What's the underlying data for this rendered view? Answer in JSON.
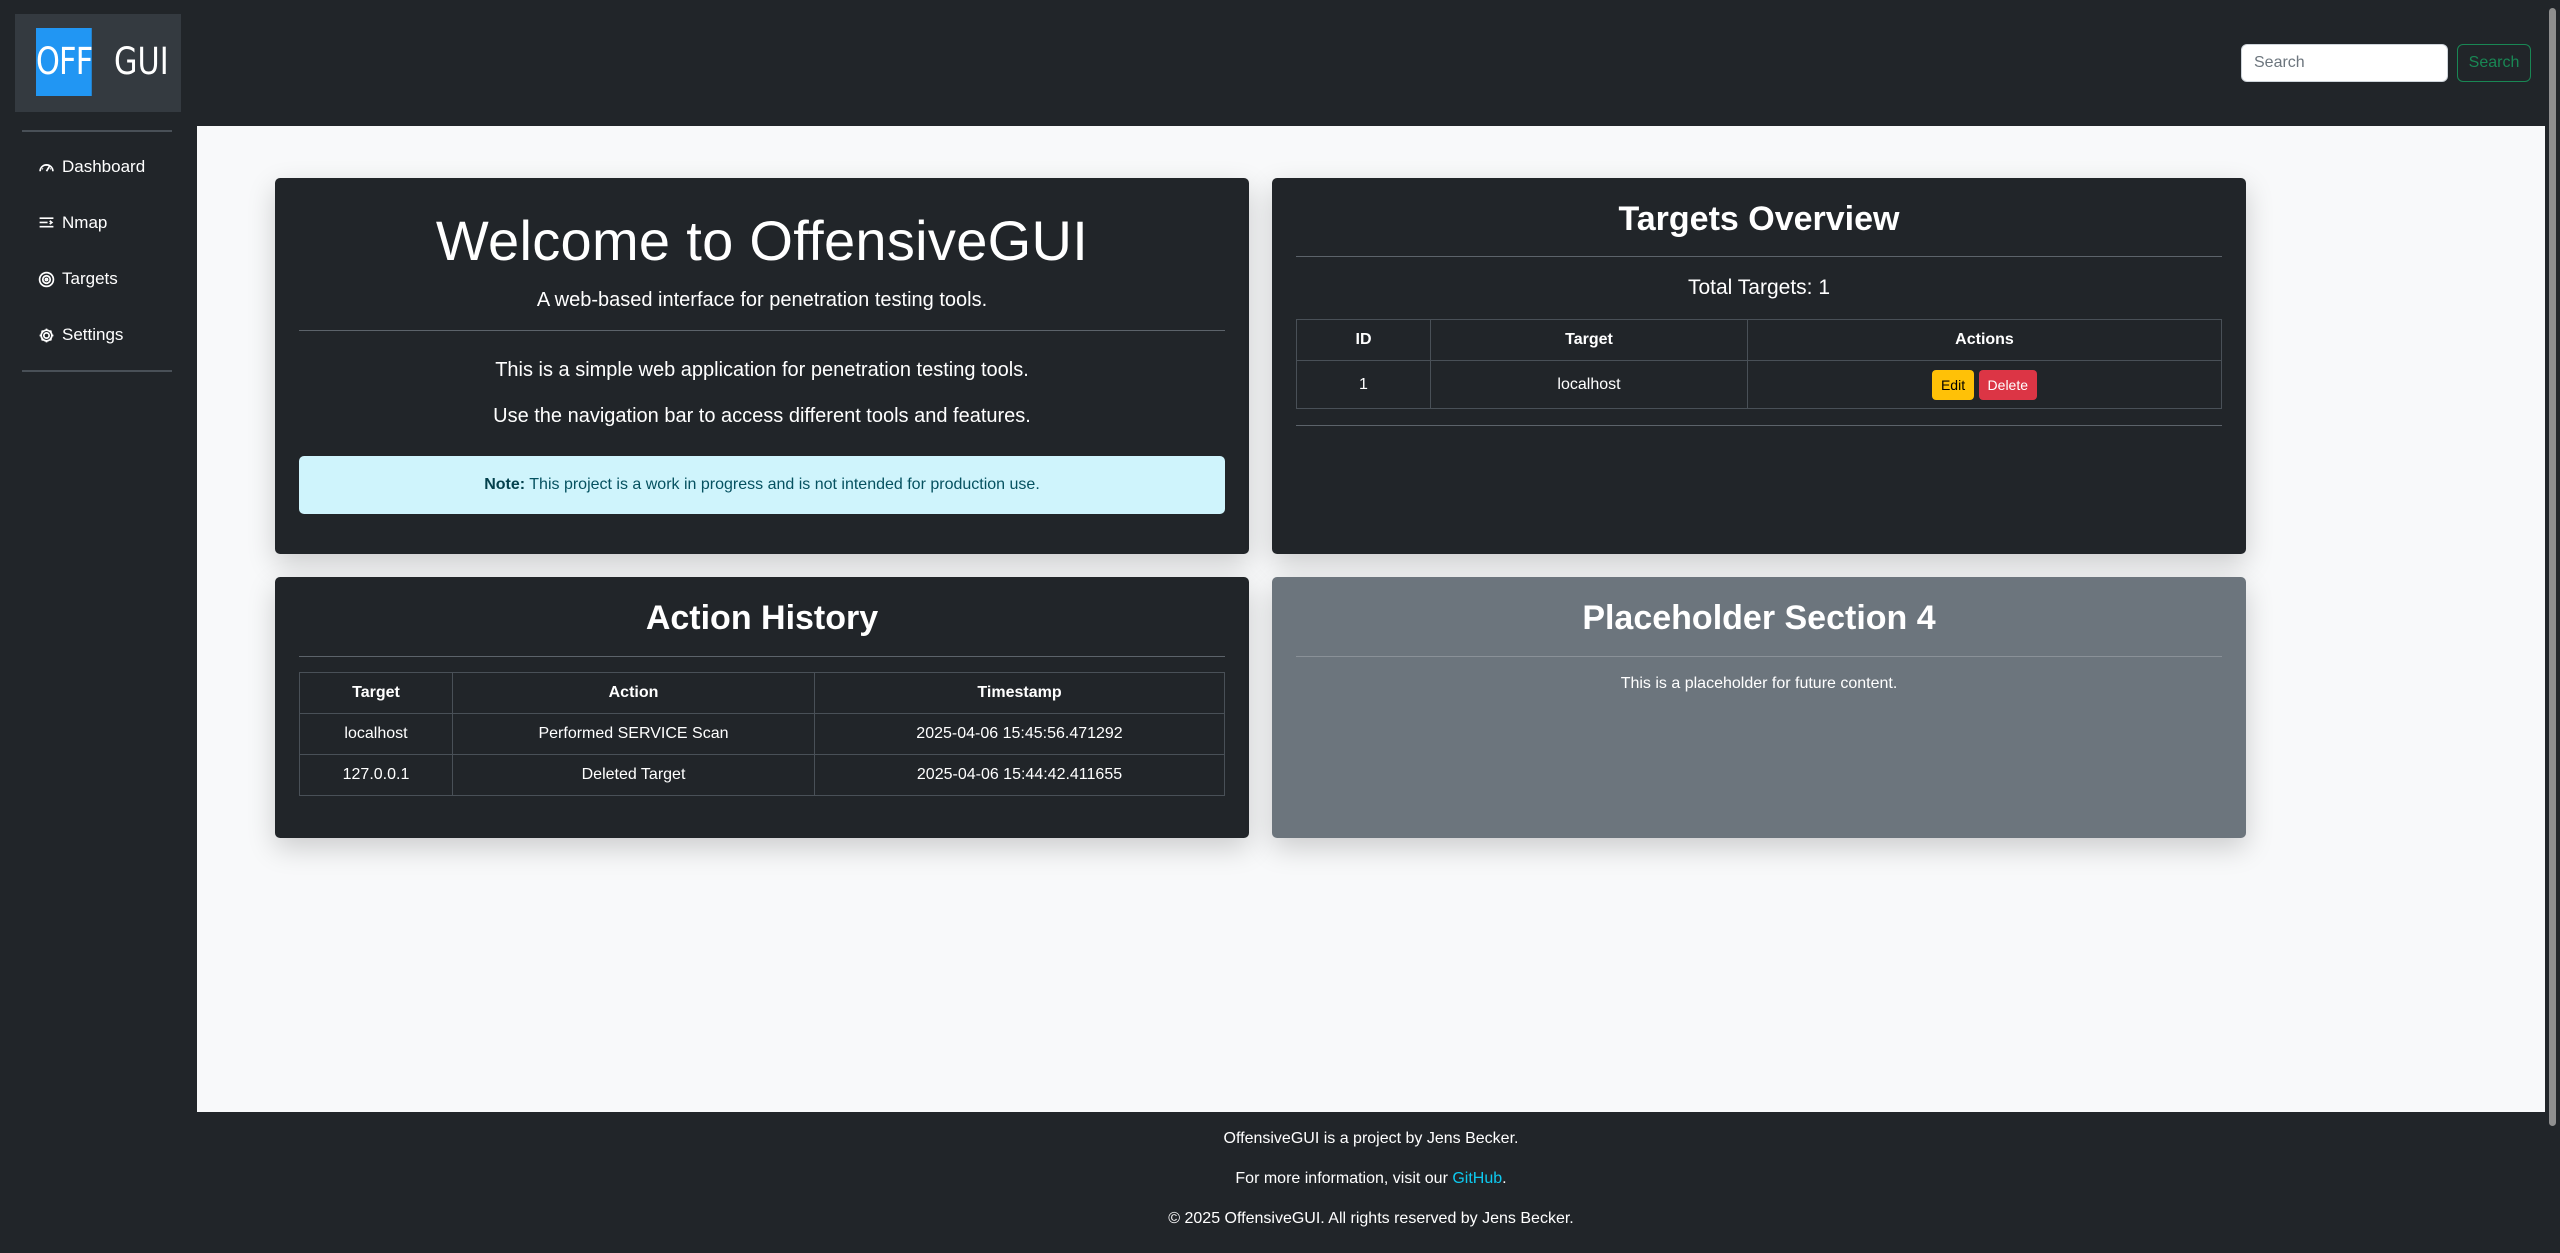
{
  "logo": {
    "left": "OFF",
    "right": "GUI"
  },
  "sidebar": {
    "items": [
      {
        "label": "Dashboard",
        "icon": "speedometer-icon"
      },
      {
        "label": "Nmap",
        "icon": "terminal-icon"
      },
      {
        "label": "Targets",
        "icon": "target-icon"
      },
      {
        "label": "Settings",
        "icon": "gear-icon"
      }
    ]
  },
  "search": {
    "placeholder": "Search",
    "button_label": "Search"
  },
  "welcome": {
    "title": "Welcome to OffensiveGUI",
    "lead": "A web-based interface for penetration testing tools.",
    "para1": "This is a simple web application for penetration testing tools.",
    "para2": "Use the navigation bar to access different tools and features.",
    "note_label": "Note:",
    "note_text": "This project is a work in progress and is not intended for production use."
  },
  "targets_overview": {
    "title": "Targets Overview",
    "total_text": "Total Targets: 1",
    "columns": [
      "ID",
      "Target",
      "Actions"
    ],
    "rows": [
      {
        "id": "1",
        "target": "localhost",
        "edit_label": "Edit",
        "delete_label": "Delete"
      }
    ]
  },
  "action_history": {
    "title": "Action History",
    "columns": [
      "Target",
      "Action",
      "Timestamp"
    ],
    "rows": [
      {
        "target": "localhost",
        "action": "Performed SERVICE Scan",
        "timestamp": "2025-04-06 15:45:56.471292"
      },
      {
        "target": "127.0.0.1",
        "action": "Deleted Target",
        "timestamp": "2025-04-06 15:44:42.411655"
      }
    ]
  },
  "placeholder4": {
    "title": "Placeholder Section 4",
    "text": "This is a placeholder for future content."
  },
  "footer": {
    "line1": "OffensiveGUI is a project by Jens Becker.",
    "line2_prefix": "For more information, visit our ",
    "line2_link": "GitHub",
    "line2_suffix": ".",
    "line3": "© 2025 OffensiveGUI. All rights reserved by Jens Becker."
  },
  "colors": {
    "background_dark": "#212529",
    "main_background": "#f8f9fa",
    "logo_accent": "#2196f3",
    "search_button": "#198754",
    "edit_button": "#ffc107",
    "delete_button": "#dc3545",
    "note_background": "#cff4fc",
    "placeholder_card": "#6c757d",
    "link": "#0dcaf0"
  }
}
